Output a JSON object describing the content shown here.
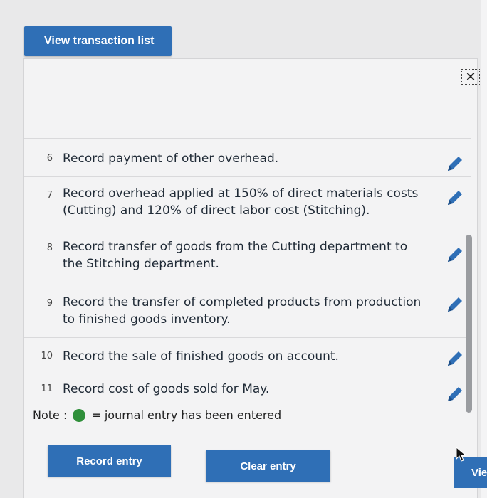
{
  "header": {
    "view_list_label": "View transaction list",
    "close_symbol": "✕"
  },
  "transactions": [
    {
      "number": "6",
      "description": "Record payment of other overhead."
    },
    {
      "number": "7",
      "description": "Record overhead applied at 150% of direct materials costs (Cutting) and 120% of direct labor cost (Stitching)."
    },
    {
      "number": "8",
      "description": "Record transfer of goods from the Cutting department to the Stitching department."
    },
    {
      "number": "9",
      "description": "Record the transfer of completed products from production to finished goods inventory."
    },
    {
      "number": "10",
      "description": "Record the sale of finished goods on account."
    },
    {
      "number": "11",
      "description": "Record cost of goods sold for May."
    }
  ],
  "note": {
    "prefix": "Note :",
    "suffix": "= journal entry has been entered",
    "entered_color": "#2f8f3a"
  },
  "actions": {
    "record_label": "Record entry",
    "clear_label": "Clear entry",
    "view_label": "Vie"
  },
  "icons": {
    "edit": "pencil-icon",
    "close": "close-icon"
  },
  "colors": {
    "primary": "#2f6fb6"
  }
}
